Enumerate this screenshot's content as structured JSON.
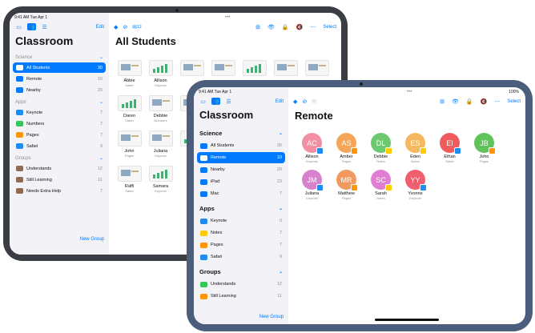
{
  "colors": {
    "accent": "#007aff",
    "frame_back": "#3a3d44",
    "frame_front": "#4b5f7c",
    "sidebar_bg": "#f2f2f7"
  },
  "back": {
    "status": {
      "time": "9:41 AM  Tue Apr 1"
    },
    "sidebar": {
      "edit": "Edit",
      "title": "Classroom",
      "sections": [
        {
          "label": "Science",
          "items": [
            {
              "label": "All Students",
              "count": "30",
              "selected": true,
              "icon": "atom-icon",
              "icon_color": "#007aff"
            },
            {
              "label": "Remote",
              "count": "10",
              "icon": "cloud-icon",
              "icon_color": "#007aff"
            },
            {
              "label": "Nearby",
              "count": "20",
              "icon": "person-card-icon",
              "icon_color": "#007aff"
            }
          ]
        },
        {
          "label": "Apps",
          "items": [
            {
              "label": "Keynote",
              "count": "7",
              "icon": "keynote-icon",
              "icon_color": "#1e8cf0"
            },
            {
              "label": "Numbers",
              "count": "7",
              "icon": "numbers-icon",
              "icon_color": "#34c759"
            },
            {
              "label": "Pages",
              "count": "7",
              "icon": "pages-icon",
              "icon_color": "#ff9500"
            },
            {
              "label": "Safari",
              "count": "9",
              "icon": "safari-icon",
              "icon_color": "#1e8cf0"
            }
          ]
        },
        {
          "label": "Groups",
          "items": [
            {
              "label": "Understands",
              "count": "12",
              "icon": "group-icon",
              "icon_color": "#8e6b52"
            },
            {
              "label": "Still Learning",
              "count": "11",
              "icon": "group-icon",
              "icon_color": "#8e6b52"
            },
            {
              "label": "Needs Extra Help",
              "count": "7",
              "icon": "group-icon",
              "icon_color": "#8e6b52"
            }
          ]
        }
      ],
      "new_group": "New Group"
    },
    "main": {
      "toolbar_count": "12",
      "title": "All Students",
      "select": "Select",
      "students": [
        {
          "name": "Abbie",
          "app": "Safari"
        },
        {
          "name": "Allison",
          "app": "Keynote"
        },
        {
          "name": "",
          "app": ""
        },
        {
          "name": "",
          "app": ""
        },
        {
          "name": "",
          "app": ""
        },
        {
          "name": "",
          "app": ""
        },
        {
          "name": "",
          "app": ""
        },
        {
          "name": "Daren",
          "app": "Safari"
        },
        {
          "name": "Debbie",
          "app": "Numbers"
        },
        {
          "name": "",
          "app": ""
        },
        {
          "name": "",
          "app": ""
        },
        {
          "name": "",
          "app": ""
        },
        {
          "name": "",
          "app": ""
        },
        {
          "name": "",
          "app": ""
        },
        {
          "name": "John",
          "app": "Pages"
        },
        {
          "name": "Juliana",
          "app": "Keynote"
        },
        {
          "name": "",
          "app": ""
        },
        {
          "name": "",
          "app": ""
        },
        {
          "name": "",
          "app": ""
        },
        {
          "name": "",
          "app": ""
        },
        {
          "name": "",
          "app": ""
        },
        {
          "name": "Raffi",
          "app": "Safari"
        },
        {
          "name": "Samara",
          "app": "Keynote"
        }
      ]
    }
  },
  "front": {
    "status": {
      "time": "9:41 AM  Tue Apr 1",
      "battery": "100%"
    },
    "sidebar": {
      "edit": "Edit",
      "title": "Classroom",
      "sections": [
        {
          "label": "Science",
          "items": [
            {
              "label": "All Students",
              "count": "30",
              "icon": "atom-icon",
              "icon_color": "#007aff"
            },
            {
              "label": "Remote",
              "count": "10",
              "selected": true,
              "icon": "cloud-icon",
              "icon_color": "#007aff"
            },
            {
              "label": "Nearby",
              "count": "20",
              "icon": "person-card-icon",
              "icon_color": "#007aff"
            },
            {
              "label": "iPad",
              "count": "23",
              "icon": "ipad-icon",
              "icon_color": "#007aff"
            },
            {
              "label": "Mac",
              "count": "7",
              "icon": "mac-icon",
              "icon_color": "#007aff"
            }
          ]
        },
        {
          "label": "Apps",
          "items": [
            {
              "label": "Keynote",
              "count": "0",
              "icon": "keynote-icon",
              "icon_color": "#1e8cf0"
            },
            {
              "label": "Notes",
              "count": "7",
              "icon": "notes-icon",
              "icon_color": "#ffcc00"
            },
            {
              "label": "Pages",
              "count": "7",
              "icon": "pages-icon",
              "icon_color": "#ff9500"
            },
            {
              "label": "Safari",
              "count": "9",
              "icon": "safari-icon",
              "icon_color": "#1e8cf0"
            }
          ]
        },
        {
          "label": "Groups",
          "items": [
            {
              "label": "Understands",
              "count": "12",
              "icon": "group-icon",
              "icon_color": "#34c759"
            },
            {
              "label": "Still Learning",
              "count": "11",
              "icon": "group-icon",
              "icon_color": "#ff9500"
            }
          ]
        }
      ],
      "new_group": "New Group"
    },
    "main": {
      "title": "Remote",
      "select": "Select",
      "students": [
        {
          "initials": "AC",
          "name": "Allison",
          "app": "Keynote",
          "color": "#f38fa3",
          "badge_color": "#1e8cf0"
        },
        {
          "initials": "AS",
          "name": "Amber",
          "app": "Pages",
          "color": "#f5a55a",
          "badge_color": "#ff9500"
        },
        {
          "initials": "DL",
          "name": "Debbie",
          "app": "Notes",
          "color": "#6cc970",
          "badge_color": "#ffcc00"
        },
        {
          "initials": "ES",
          "name": "Eden",
          "app": "Notes",
          "color": "#f5b860",
          "badge_color": "#ffcc00"
        },
        {
          "initials": "EI",
          "name": "Ethan",
          "app": "Safari",
          "color": "#ef5b5b",
          "badge_color": "#1e8cf0"
        },
        {
          "initials": "JB",
          "name": "John",
          "app": "Pages",
          "color": "#5fc35a",
          "badge_color": "#ff9500"
        },
        {
          "initials": "JM",
          "name": "Juliana",
          "app": "Keynote",
          "color": "#d882cf",
          "badge_color": "#1e8cf0"
        },
        {
          "initials": "MR",
          "name": "Matthew",
          "app": "Pages",
          "color": "#f09a5f",
          "badge_color": "#ff9500"
        },
        {
          "initials": "SC",
          "name": "Sarah",
          "app": "Notes",
          "color": "#e17ed4",
          "badge_color": "#ffcc00"
        },
        {
          "initials": "YY",
          "name": "Yvonne",
          "app": "Keynote",
          "color": "#ef5f6e",
          "badge_color": "#1e8cf0"
        }
      ]
    }
  }
}
